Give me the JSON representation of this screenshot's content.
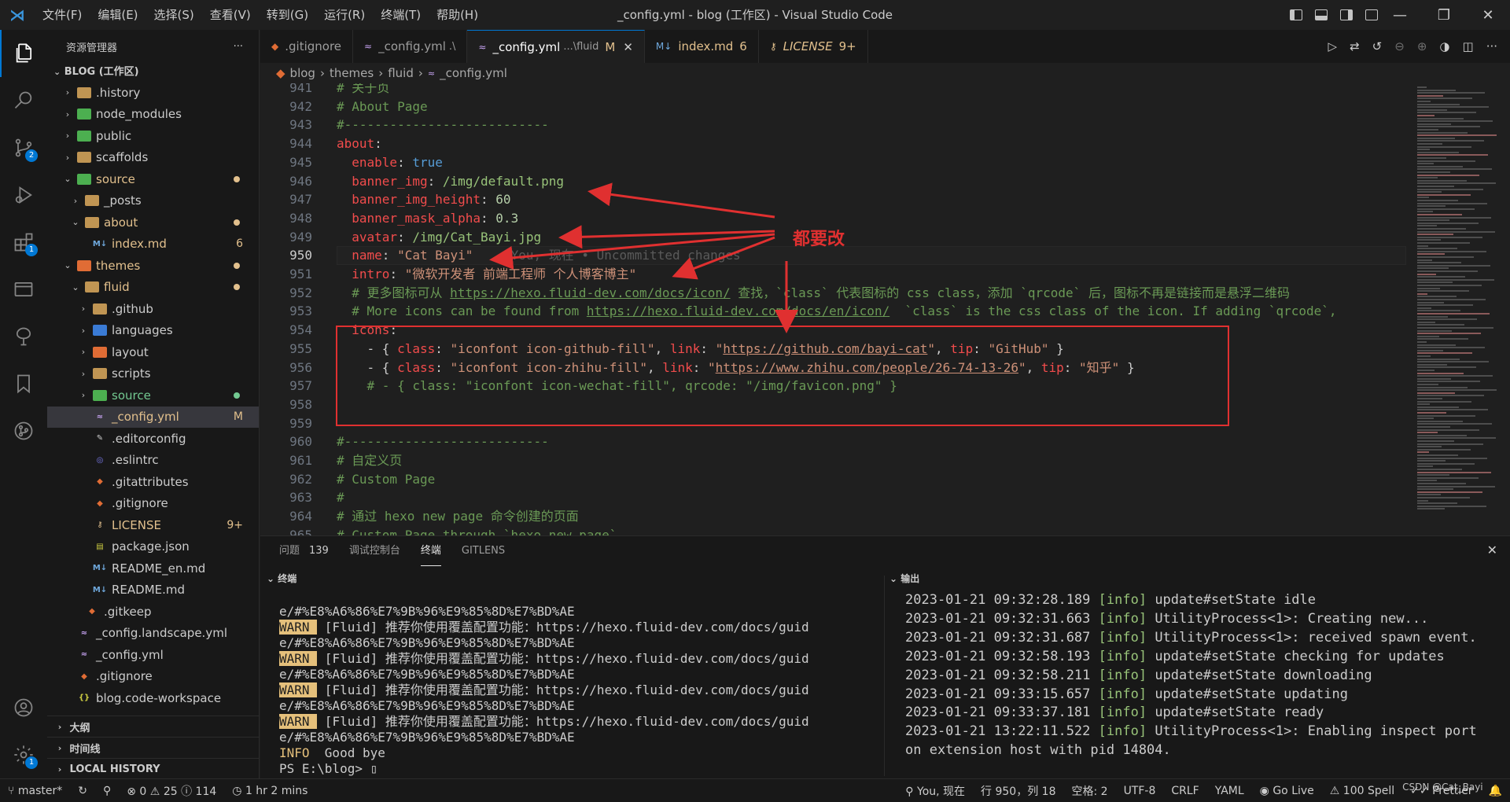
{
  "titlebar": {
    "menus": [
      "文件(F)",
      "编辑(E)",
      "选择(S)",
      "查看(V)",
      "转到(G)",
      "运行(R)",
      "终端(T)",
      "帮助(H)"
    ],
    "window_title": "_config.yml - blog (工作区) - Visual Studio Code"
  },
  "activity": {
    "scm_badge": "2",
    "extensions_badge": "1",
    "settings_badge": "1"
  },
  "sidebar": {
    "title": "资源管理器",
    "more": "···",
    "workspace": "BLOG (工作区)",
    "items": [
      {
        "indent": 1,
        "twisty": "›",
        "icon": "folder",
        "label": ".history"
      },
      {
        "indent": 1,
        "twisty": "›",
        "icon": "folder-green",
        "label": "node_modules"
      },
      {
        "indent": 1,
        "twisty": "›",
        "icon": "folder-green",
        "label": "public"
      },
      {
        "indent": 1,
        "twisty": "›",
        "icon": "folder",
        "label": "scaffolds"
      },
      {
        "indent": 1,
        "twisty": "⌄",
        "icon": "folder-green",
        "label": "source",
        "color": "#e2c08d",
        "dot": true
      },
      {
        "indent": 2,
        "twisty": "›",
        "icon": "folder",
        "label": "_posts"
      },
      {
        "indent": 2,
        "twisty": "⌄",
        "icon": "folder",
        "label": "about",
        "color": "#e2c08d",
        "dot": true
      },
      {
        "indent": 3,
        "twisty": "",
        "icon": "md",
        "label": "index.md",
        "color": "#e2c08d",
        "badge": "6"
      },
      {
        "indent": 1,
        "twisty": "⌄",
        "icon": "folder-orange",
        "label": "themes",
        "color": "#e2c08d",
        "dot": true
      },
      {
        "indent": 2,
        "twisty": "⌄",
        "icon": "folder",
        "label": "fluid",
        "color": "#e2c08d",
        "dot": true
      },
      {
        "indent": 3,
        "twisty": "›",
        "icon": "folder",
        "label": ".github"
      },
      {
        "indent": 3,
        "twisty": "›",
        "icon": "folder-blue",
        "label": "languages"
      },
      {
        "indent": 3,
        "twisty": "›",
        "icon": "folder-orange",
        "label": "layout"
      },
      {
        "indent": 3,
        "twisty": "›",
        "icon": "folder",
        "label": "scripts"
      },
      {
        "indent": 3,
        "twisty": "›",
        "icon": "folder-green",
        "label": "source",
        "color": "#73c991",
        "dot": true
      },
      {
        "indent": 3,
        "twisty": "",
        "icon": "yml",
        "label": "_config.yml",
        "color": "#e2c08d",
        "badge": "M",
        "selected": true
      },
      {
        "indent": 3,
        "twisty": "",
        "icon": "editorconfig",
        "label": ".editorconfig"
      },
      {
        "indent": 3,
        "twisty": "",
        "icon": "eslint",
        "label": ".eslintrc"
      },
      {
        "indent": 3,
        "twisty": "",
        "icon": "git",
        "label": ".gitattributes"
      },
      {
        "indent": 3,
        "twisty": "",
        "icon": "git",
        "label": ".gitignore"
      },
      {
        "indent": 3,
        "twisty": "",
        "icon": "license",
        "label": "LICENSE",
        "color": "#e2c08d",
        "badge": "9+"
      },
      {
        "indent": 3,
        "twisty": "",
        "icon": "json",
        "label": "package.json"
      },
      {
        "indent": 3,
        "twisty": "",
        "icon": "md",
        "label": "README_en.md"
      },
      {
        "indent": 3,
        "twisty": "",
        "icon": "md",
        "label": "README.md"
      },
      {
        "indent": 2,
        "twisty": "",
        "icon": "git",
        "label": ".gitkeep"
      },
      {
        "indent": 1,
        "twisty": "",
        "icon": "yml",
        "label": "_config.landscape.yml"
      },
      {
        "indent": 1,
        "twisty": "",
        "icon": "yml",
        "label": "_config.yml"
      },
      {
        "indent": 1,
        "twisty": "",
        "icon": "git",
        "label": ".gitignore"
      },
      {
        "indent": 1,
        "twisty": "",
        "icon": "braces",
        "label": "blog.code-workspace"
      }
    ],
    "sections": [
      "大纲",
      "时间线",
      "LOCAL HISTORY"
    ]
  },
  "tabs": [
    {
      "icon": "git",
      "name": ".gitignore",
      "ext": "",
      "mod": ""
    },
    {
      "icon": "yml",
      "name": "_config.yml",
      "ext": ".\\",
      "mod": ""
    },
    {
      "icon": "yml",
      "name": "_config.yml",
      "ext": "...\\fluid",
      "mod": "M",
      "active": true
    },
    {
      "icon": "md",
      "name": "index.md",
      "ext": "",
      "mod": "6",
      "color": "#e2c08d"
    },
    {
      "icon": "license",
      "name": "LICENSE",
      "ext": "",
      "mod": "9+",
      "color": "#e2c08d",
      "italic": true
    }
  ],
  "breadcrumb": [
    "blog",
    "themes",
    "fluid",
    "_config.yml"
  ],
  "editor": {
    "current_line": 950,
    "lines": [
      {
        "n": "941",
        "html": "<span class='c'># 关于页</span>"
      },
      {
        "n": "942",
        "html": "<span class='c'># About Page</span>"
      },
      {
        "n": "943",
        "html": "<span class='c'>#---------------------------</span>"
      },
      {
        "n": "944",
        "html": "<span class='k'>about</span><span class='p'>:</span>"
      },
      {
        "n": "945",
        "html": "  <span class='k'>enable</span><span class='p'>: </span><span class='b'>true</span>"
      },
      {
        "n": "946",
        "html": "  <span class='k'>banner_img</span><span class='p'>: </span><span class='g'>/img/default.png</span>"
      },
      {
        "n": "947",
        "html": "  <span class='k'>banner_img_height</span><span class='p'>: </span><span class='n'>60</span>"
      },
      {
        "n": "948",
        "html": "  <span class='k'>banner_mask_alpha</span><span class='p'>: </span><span class='n'>0.3</span>"
      },
      {
        "n": "949",
        "html": "  <span class='k'>avatar</span><span class='p'>: </span><span class='g'>/img/Cat_Bayi.jpg</span>"
      },
      {
        "n": "950",
        "html": "  <span class='k'>name</span><span class='p'>: </span><span class='s'>\"Cat Bayi\"</span>     <span class='blame'>You, 现在 • Uncommitted changes</span>"
      },
      {
        "n": "951",
        "html": "  <span class='k'>intro</span><span class='p'>: </span><span class='s'>\"微软开发者 前端工程师 个人博客博主\"</span>"
      },
      {
        "n": "952",
        "html": "  <span class='c'># 更多图标可从 <span class='u'>https://hexo.fluid-dev.com/docs/icon/</span> 查找，`class` 代表图标的 css class，添加 `qrcode` 后，图标不再是链接而是悬浮二维码</span>"
      },
      {
        "n": "953",
        "html": "  <span class='c'># More icons can be found from <span class='u'>https://hexo.fluid-dev.com/docs/en/icon/</span>  `class` is the css class of the icon. If adding `qrcode`,</span>"
      },
      {
        "n": "954",
        "html": "  <span class='k'>icons</span><span class='p'>:</span>"
      },
      {
        "n": "955",
        "html": "    <span class='p'>- { </span><span class='k'>class</span><span class='p'>: </span><span class='s'>\"iconfont icon-github-fill\"</span><span class='p'>, </span><span class='k'>link</span><span class='p'>: </span><span class='s'>\"<span class='u'>https://github.com/bayi-cat</span>\"</span><span class='p'>, </span><span class='k'>tip</span><span class='p'>: </span><span class='s'>\"GitHub\"</span><span class='p'> }</span>"
      },
      {
        "n": "956",
        "html": "    <span class='p'>- { </span><span class='k'>class</span><span class='p'>: </span><span class='s'>\"iconfont icon-zhihu-fill\"</span><span class='p'>, </span><span class='k'>link</span><span class='p'>: </span><span class='s'>\"<span class='u'>https://www.zhihu.com/people/26-74-13-26</span>\"</span><span class='p'>, </span><span class='k'>tip</span><span class='p'>: </span><span class='s'>\"知乎\"</span><span class='p'> }</span>"
      },
      {
        "n": "957",
        "html": "    <span class='c'># - { class: \"iconfont icon-wechat-fill\", qrcode: \"/img/favicon.png\" }</span>"
      },
      {
        "n": "958",
        "html": ""
      },
      {
        "n": "959",
        "html": ""
      },
      {
        "n": "960",
        "html": "<span class='c'>#---------------------------</span>"
      },
      {
        "n": "961",
        "html": "<span class='c'># 自定义页</span>"
      },
      {
        "n": "962",
        "html": "<span class='c'># Custom Page</span>"
      },
      {
        "n": "963",
        "html": "<span class='c'>#</span>"
      },
      {
        "n": "964",
        "html": "<span class='c'># 通过 hexo new page 命令创建的页面</span>"
      },
      {
        "n": "965",
        "html": "<span class='c'># Custom Page through `hexo new page`</span>"
      }
    ]
  },
  "annotation": {
    "label": "都要改",
    "color": "#e03030"
  },
  "panel": {
    "tabs": [
      {
        "label": "问题",
        "count": "139"
      },
      {
        "label": "调试控制台"
      },
      {
        "label": "终端",
        "active": true
      },
      {
        "label": "GITLENS"
      }
    ],
    "terminal_title": "终端",
    "output_title": "输出",
    "terminal_lines": [
      {
        "html": "e/#%E8%A6%86%E7%9B%96%E9%85%8D%E7%BD%AE"
      },
      {
        "html": "<span class='warn'>WARN </span> [Fluid] 推荐你使用覆盖配置功能：https://hexo.fluid-dev.com/docs/guid"
      },
      {
        "html": "e/#%E8%A6%86%E7%9B%96%E9%85%8D%E7%BD%AE"
      },
      {
        "html": "<span class='warn'>WARN </span> [Fluid] 推荐你使用覆盖配置功能：https://hexo.fluid-dev.com/docs/guid"
      },
      {
        "html": "e/#%E8%A6%86%E7%9B%96%E9%85%8D%E7%BD%AE"
      },
      {
        "html": "<span class='warn'>WARN </span> [Fluid] 推荐你使用覆盖配置功能：https://hexo.fluid-dev.com/docs/guid"
      },
      {
        "html": "e/#%E8%A6%86%E7%9B%96%E9%85%8D%E7%BD%AE"
      },
      {
        "html": "<span class='warn'>WARN </span> [Fluid] 推荐你使用覆盖配置功能：https://hexo.fluid-dev.com/docs/guid"
      },
      {
        "html": "e/#%E8%A6%86%E7%9B%96%E9%85%8D%E7%BD%AE"
      },
      {
        "html": "<span class='info'>INFO</span>  Good bye"
      },
      {
        "html": "PS E:\\blog> ▯"
      }
    ],
    "output_lines": [
      {
        "ts": "2023-01-21 09:32:28.189",
        "tag": "[info]",
        "msg": " update#setState idle"
      },
      {
        "ts": "2023-01-21 09:32:31.663",
        "tag": "[info]",
        "msg": " UtilityProcess<1>: Creating new..."
      },
      {
        "ts": "2023-01-21 09:32:31.687",
        "tag": "[info]",
        "msg": " UtilityProcess<1>: received spawn event."
      },
      {
        "ts": "2023-01-21 09:32:58.193",
        "tag": "[info]",
        "msg": " update#setState checking for updates"
      },
      {
        "ts": "2023-01-21 09:32:58.211",
        "tag": "[info]",
        "msg": " update#setState downloading"
      },
      {
        "ts": "2023-01-21 09:33:15.657",
        "tag": "[info]",
        "msg": " update#setState updating"
      },
      {
        "ts": "2023-01-21 09:33:37.181",
        "tag": "[info]",
        "msg": " update#setState ready"
      },
      {
        "ts": "2023-01-21 13:22:11.522",
        "tag": "[info]",
        "msg": " UtilityProcess<1>: Enabling inspect port"
      },
      {
        "ts": "on extension host with pid",
        "tag": "",
        "msg": " 14804."
      }
    ]
  },
  "statusbar": {
    "branch": "master*",
    "errors": "0",
    "warnings": "25",
    "infos": "114",
    "time": "1 hr 2 mins",
    "blame": "You, 现在",
    "position": "行 950，列 18",
    "spaces": "空格: 2",
    "encoding": "UTF-8",
    "eol": "CRLF",
    "language": "YAML",
    "golive": "Go Live",
    "spell": "100 Spell",
    "prettier": "Prettier",
    "watermark": "CSDN @Cat_Bayi"
  }
}
